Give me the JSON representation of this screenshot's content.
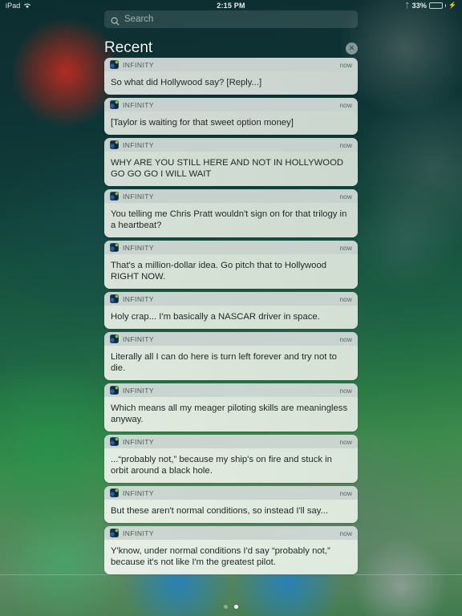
{
  "status_bar": {
    "device_label": "iPad",
    "wifi_icon": "wifi-icon",
    "time": "2:15 PM",
    "bluetooth_icon": "bluetooth-icon",
    "battery_percent": "33%",
    "battery_level": 33,
    "charging_icon": "lightning-bolt-icon"
  },
  "search": {
    "icon": "search-icon",
    "placeholder": "Search",
    "value": ""
  },
  "recent": {
    "title": "Recent",
    "clear_icon": "close-circle-icon"
  },
  "notifications": [
    {
      "app": "INFINITY",
      "time": "now",
      "message": "So what did Hollywood say? [Reply...]"
    },
    {
      "app": "INFINITY",
      "time": "now",
      "message": "[Taylor is waiting for that sweet option money]"
    },
    {
      "app": "INFINITY",
      "time": "now",
      "message": "WHY ARE YOU STILL HERE AND NOT IN HOLLYWOOD GO GO GO I WILL WAIT"
    },
    {
      "app": "INFINITY",
      "time": "now",
      "message": "You telling me Chris Pratt wouldn't sign on for that trilogy in a heartbeat?"
    },
    {
      "app": "INFINITY",
      "time": "now",
      "message": "That's a million-dollar idea. Go pitch that to Hollywood RIGHT NOW."
    },
    {
      "app": "INFINITY",
      "time": "now",
      "message": "Holy crap... I'm basically a NASCAR driver in space."
    },
    {
      "app": "INFINITY",
      "time": "now",
      "message": "Literally all I can do here is turn left forever and try not to die."
    },
    {
      "app": "INFINITY",
      "time": "now",
      "message": "Which means all my meager piloting skills are meaningless anyway."
    },
    {
      "app": "INFINITY",
      "time": "now",
      "message": "...“probably not,” because my ship's on fire and stuck in orbit around a black hole."
    },
    {
      "app": "INFINITY",
      "time": "now",
      "message": "But these aren't normal conditions, so instead I'll say..."
    },
    {
      "app": "INFINITY",
      "time": "now",
      "message": "Y'know, under normal conditions I'd say “probably not,” because it's not like I'm the greatest pilot."
    }
  ],
  "page_dots": {
    "count": 2,
    "active_index": 1
  }
}
